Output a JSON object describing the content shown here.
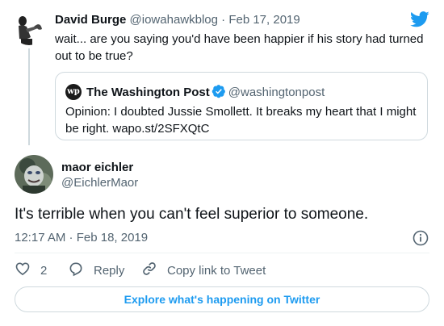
{
  "brand": {
    "logo_icon": "twitter-bird-icon",
    "accent": "#1d9bf0"
  },
  "parent_tweet": {
    "name": "David Burge",
    "handle": "@iowahawkblog",
    "separator": "·",
    "date": "Feb 17, 2019",
    "text": "wait... are you saying you'd have been happier if his story had turned out to be true?"
  },
  "quote_tweet": {
    "logo_text": "wp",
    "name": "The Washington Post",
    "verified_icon": "verified-badge-icon",
    "handle": "@washingtonpost",
    "text": "Opinion: I doubted Jussie Smollett. It breaks my heart that I might be right. wapo.st/2SFXQtC"
  },
  "main_tweet": {
    "name": "maor eichler",
    "handle": "@EichlerMaor",
    "text": "It's terrible when you can't feel superior to someone.",
    "timestamp": "12:17 AM · Feb 18, 2019"
  },
  "actions": {
    "like_count": "2",
    "reply_label": "Reply",
    "copy_label": "Copy link to Tweet"
  },
  "explore_label": "Explore what's happening on Twitter"
}
